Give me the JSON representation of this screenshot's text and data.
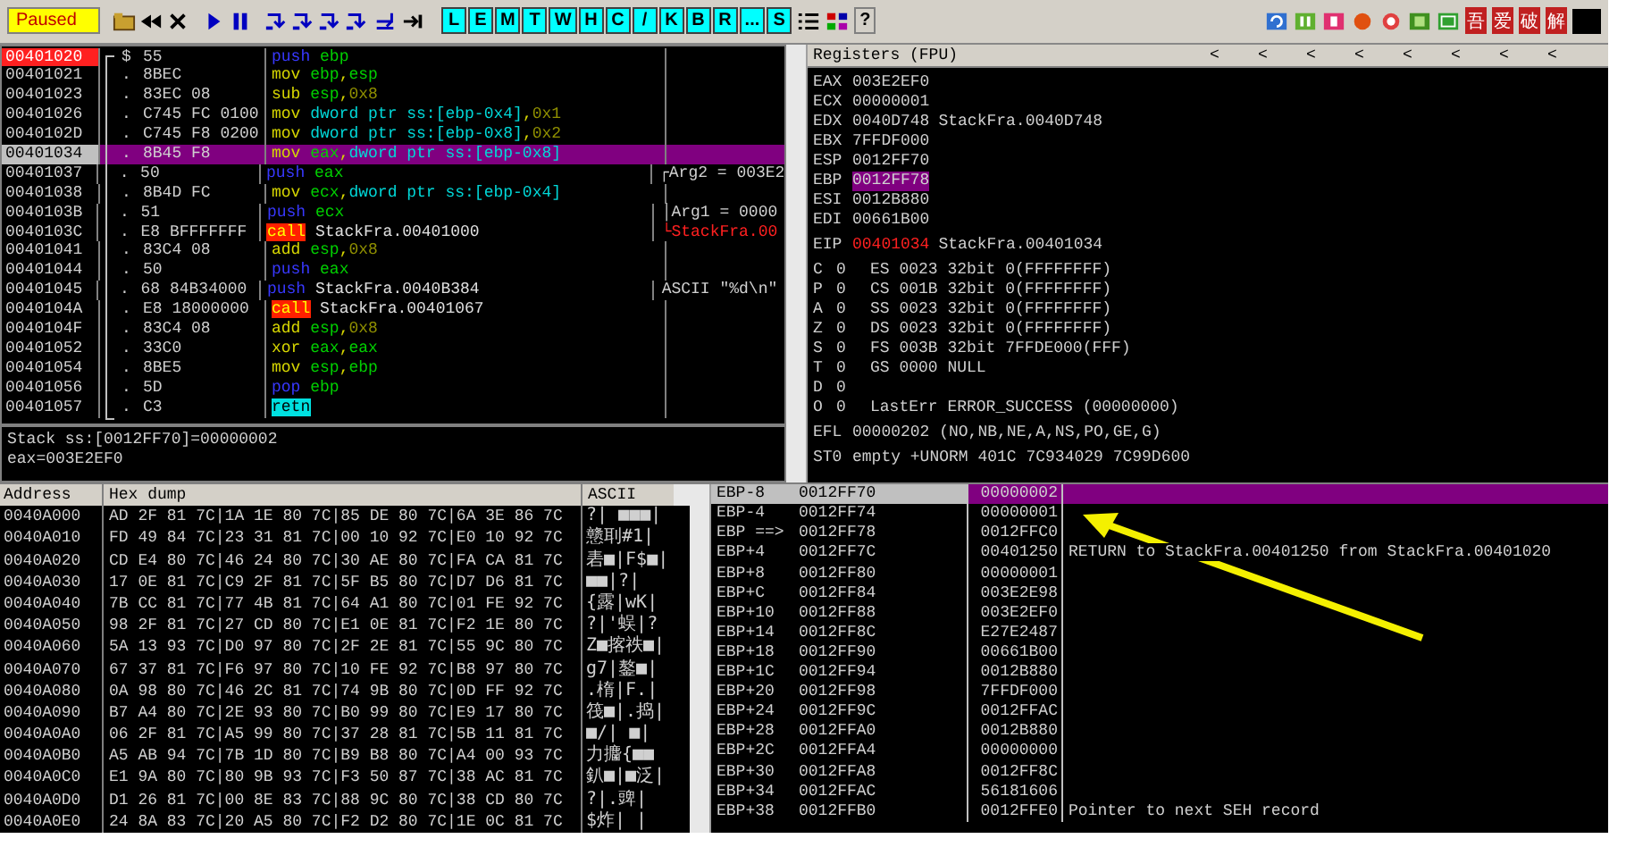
{
  "toolbar": {
    "status": "Paused",
    "letter_buttons": [
      "L",
      "E",
      "M",
      "T",
      "W",
      "H",
      "C",
      "/",
      "K",
      "B",
      "R",
      "...",
      "S"
    ],
    "help_button": "?",
    "brand_buttons": [
      "吾",
      "爱",
      "破",
      "解"
    ]
  },
  "disassembly": {
    "rows": [
      {
        "address": "00401020",
        "marker": "$",
        "bytes": "55",
        "mnemonic": {
          "text": "push",
          "kind": "stack"
        },
        "operands": [
          {
            "text": "ebp",
            "kind": "reg"
          }
        ],
        "breakpoint": true,
        "selected": false
      },
      {
        "address": "00401021",
        "marker": ".",
        "bytes": "8BEC",
        "mnemonic": {
          "text": "mov",
          "kind": "data"
        },
        "operands": [
          {
            "text": "ebp",
            "kind": "reg"
          },
          {
            "text": ",",
            "kind": "punct"
          },
          {
            "text": "esp",
            "kind": "reg"
          }
        ],
        "breakpoint": false,
        "selected": false
      },
      {
        "address": "00401023",
        "marker": ".",
        "bytes": "83EC 08",
        "mnemonic": {
          "text": "sub",
          "kind": "data"
        },
        "operands": [
          {
            "text": "esp",
            "kind": "reg"
          },
          {
            "text": ",",
            "kind": "punct"
          },
          {
            "text": "0x8",
            "kind": "imm"
          }
        ],
        "breakpoint": false,
        "selected": false
      },
      {
        "address": "00401026",
        "marker": ".",
        "bytes": "C745 FC 0100",
        "mnemonic": {
          "text": "mov",
          "kind": "data"
        },
        "operands": [
          {
            "text": "dword ptr ss:[ebp-0x4]",
            "kind": "mem"
          },
          {
            "text": ",",
            "kind": "punct"
          },
          {
            "text": "0x1",
            "kind": "imm"
          }
        ],
        "breakpoint": false,
        "selected": false
      },
      {
        "address": "0040102D",
        "marker": ".",
        "bytes": "C745 F8 0200",
        "mnemonic": {
          "text": "mov",
          "kind": "data"
        },
        "operands": [
          {
            "text": "dword ptr ss:[ebp-0x8]",
            "kind": "mem"
          },
          {
            "text": ",",
            "kind": "punct"
          },
          {
            "text": "0x2",
            "kind": "imm"
          }
        ],
        "breakpoint": false,
        "selected": false
      },
      {
        "address": "00401034",
        "marker": ".",
        "bytes": "8B45 F8",
        "mnemonic": {
          "text": "mov",
          "kind": "data"
        },
        "operands": [
          {
            "text": "eax",
            "kind": "reg"
          },
          {
            "text": ",",
            "kind": "punct"
          },
          {
            "text": "dword ptr ss:[ebp-0x8]",
            "kind": "mem"
          }
        ],
        "breakpoint": false,
        "selected": true
      },
      {
        "address": "00401037",
        "marker": ".",
        "bytes": "50",
        "mnemonic": {
          "text": "push",
          "kind": "stack"
        },
        "operands": [
          {
            "text": "eax",
            "kind": "reg"
          }
        ],
        "comment": {
          "text": "┌Arg2 = 003E2",
          "kind": "arg"
        },
        "breakpoint": false,
        "selected": false
      },
      {
        "address": "00401038",
        "marker": ".",
        "bytes": "8B4D FC",
        "mnemonic": {
          "text": "mov",
          "kind": "data"
        },
        "operands": [
          {
            "text": "ecx",
            "kind": "reg"
          },
          {
            "text": ",",
            "kind": "punct"
          },
          {
            "text": "dword ptr ss:[ebp-0x4]",
            "kind": "mem"
          }
        ],
        "breakpoint": false,
        "selected": false
      },
      {
        "address": "0040103B",
        "marker": ".",
        "bytes": "51",
        "mnemonic": {
          "text": "push",
          "kind": "stack"
        },
        "operands": [
          {
            "text": "ecx",
            "kind": "reg"
          }
        ],
        "comment": {
          "text": "│Arg1 = 0000",
          "kind": "arg"
        },
        "breakpoint": false,
        "selected": false
      },
      {
        "address": "0040103C",
        "marker": ".",
        "bytes": "E8 BFFFFFFF",
        "mnemonic": {
          "text": "call",
          "kind": "call"
        },
        "operands": [
          {
            "text": "StackFra.00401000",
            "kind": "sym"
          }
        ],
        "comment": {
          "text": "└StackFra.00",
          "kind": "target"
        },
        "breakpoint": false,
        "selected": false
      },
      {
        "address": "00401041",
        "marker": ".",
        "bytes": "83C4 08",
        "mnemonic": {
          "text": "add",
          "kind": "data"
        },
        "operands": [
          {
            "text": "esp",
            "kind": "reg"
          },
          {
            "text": ",",
            "kind": "punct"
          },
          {
            "text": "0x8",
            "kind": "imm"
          }
        ],
        "breakpoint": false,
        "selected": false
      },
      {
        "address": "00401044",
        "marker": ".",
        "bytes": "50",
        "mnemonic": {
          "text": "push",
          "kind": "stack"
        },
        "operands": [
          {
            "text": "eax",
            "kind": "reg"
          }
        ],
        "breakpoint": false,
        "selected": false
      },
      {
        "address": "00401045",
        "marker": ".",
        "bytes": "68 84B34000",
        "mnemonic": {
          "text": "push",
          "kind": "stack"
        },
        "operands": [
          {
            "text": "StackFra.0040B384",
            "kind": "sym"
          }
        ],
        "comment": {
          "text": "ASCII \"%d\\n\"",
          "kind": "arg"
        },
        "breakpoint": false,
        "selected": false
      },
      {
        "address": "0040104A",
        "marker": ".",
        "bytes": "E8 18000000",
        "mnemonic": {
          "text": "call",
          "kind": "call"
        },
        "operands": [
          {
            "text": "StackFra.00401067",
            "kind": "sym"
          }
        ],
        "breakpoint": false,
        "selected": false
      },
      {
        "address": "0040104F",
        "marker": ".",
        "bytes": "83C4 08",
        "mnemonic": {
          "text": "add",
          "kind": "data"
        },
        "operands": [
          {
            "text": "esp",
            "kind": "reg"
          },
          {
            "text": ",",
            "kind": "punct"
          },
          {
            "text": "0x8",
            "kind": "imm"
          }
        ],
        "breakpoint": false,
        "selected": false
      },
      {
        "address": "00401052",
        "marker": ".",
        "bytes": "33C0",
        "mnemonic": {
          "text": "xor",
          "kind": "data"
        },
        "operands": [
          {
            "text": "eax",
            "kind": "reg"
          },
          {
            "text": ",",
            "kind": "punct"
          },
          {
            "text": "eax",
            "kind": "reg"
          }
        ],
        "breakpoint": false,
        "selected": false
      },
      {
        "address": "00401054",
        "marker": ".",
        "bytes": "8BE5",
        "mnemonic": {
          "text": "mov",
          "kind": "data"
        },
        "operands": [
          {
            "text": "esp",
            "kind": "reg"
          },
          {
            "text": ",",
            "kind": "punct"
          },
          {
            "text": "ebp",
            "kind": "reg"
          }
        ],
        "breakpoint": false,
        "selected": false
      },
      {
        "address": "00401056",
        "marker": ".",
        "bytes": "5D",
        "mnemonic": {
          "text": "pop",
          "kind": "stack"
        },
        "operands": [
          {
            "text": "ebp",
            "kind": "reg"
          }
        ],
        "breakpoint": false,
        "selected": false
      },
      {
        "address": "00401057",
        "marker": ".",
        "bytes": "C3",
        "mnemonic": {
          "text": "retn",
          "kind": "ret"
        },
        "operands": [],
        "breakpoint": false,
        "selected": false
      }
    ]
  },
  "info": [
    "Stack ss:[0012FF70]=00000002",
    "eax=003E2EF0"
  ],
  "registers": {
    "title": "Registers (FPU)",
    "header_arrows": [
      "<",
      "<",
      "<",
      "<",
      "<",
      "<",
      "<",
      "<"
    ],
    "general": [
      {
        "name": "EAX",
        "value": "003E2EF0",
        "changed": false,
        "selected": false
      },
      {
        "name": "ECX",
        "value": "00000001",
        "changed": false,
        "selected": false
      },
      {
        "name": "EDX",
        "value": "0040D748",
        "note": "StackFra.0040D748",
        "changed": false,
        "selected": false
      },
      {
        "name": "EBX",
        "value": "7FFDF000",
        "changed": false,
        "selected": false
      },
      {
        "name": "ESP",
        "value": "0012FF70",
        "changed": false,
        "selected": false
      },
      {
        "name": "EBP",
        "value": "0012FF78",
        "changed": false,
        "selected": true
      },
      {
        "name": "ESI",
        "value": "0012B880",
        "changed": false,
        "selected": false
      },
      {
        "name": "EDI",
        "value": "00661B00",
        "changed": false,
        "selected": false
      }
    ],
    "eip": {
      "name": "EIP",
      "value": "00401034",
      "note": "StackFra.00401034",
      "changed": true,
      "selected": false
    },
    "flags": [
      {
        "flag": "C",
        "value": "0",
        "segment": "ES 0023 32bit 0(FFFFFFFF)"
      },
      {
        "flag": "P",
        "value": "0",
        "segment": "CS 001B 32bit 0(FFFFFFFF)"
      },
      {
        "flag": "A",
        "value": "0",
        "segment": "SS 0023 32bit 0(FFFFFFFF)"
      },
      {
        "flag": "Z",
        "value": "0",
        "segment": "DS 0023 32bit 0(FFFFFFFF)"
      },
      {
        "flag": "S",
        "value": "0",
        "segment": "FS 003B 32bit 7FFDE000(FFF)"
      },
      {
        "flag": "T",
        "value": "0",
        "segment": "GS 0000 NULL"
      },
      {
        "flag": "D",
        "value": "0"
      },
      {
        "flag": "O",
        "value": "0",
        "segment": "LastErr ERROR_SUCCESS (00000000)"
      }
    ],
    "efl": {
      "name": "EFL",
      "value": "00000202 (NO,NB,NE,A,NS,PO,GE,G)"
    },
    "fpu": [
      {
        "name": "ST0",
        "value": "empty +UNORM 401C 7C934029 7C99D600"
      }
    ]
  },
  "dump": {
    "columns": [
      "Address",
      "Hex dump",
      "ASCII"
    ],
    "rows": [
      {
        "address": "0040A000",
        "hex": "AD 2F 81 7C|1A 1E 80 7C|85 DE 80 7C|6A 3E 86 7C",
        "ascii": "?| ■■■|"
      },
      {
        "address": "0040A010",
        "hex": "FD 49 84 7C|23 31 81 7C|00 10 92 7C|E0 10 92 7C",
        "ascii": "戆刵#1|"
      },
      {
        "address": "0040A020",
        "hex": "CD E4 80 7C|46 24 80 7C|30 AE 80 7C|FA CA 81 7C",
        "ascii": "砉■|F$■|"
      },
      {
        "address": "0040A030",
        "hex": "17 0E 81 7C|C9 2F 81 7C|5F B5 80 7C|D7 D6 81 7C",
        "ascii": "■■|?|"
      },
      {
        "address": "0040A040",
        "hex": "7B CC 81 7C|77 4B 81 7C|64 A1 80 7C|01 FE 92 7C",
        "ascii": "{露|wK|"
      },
      {
        "address": "0040A050",
        "hex": "98 2F 81 7C|27 CD 80 7C|E1 0E 81 7C|F2 1E 80 7C",
        "ascii": "?|'蜈|?"
      },
      {
        "address": "0040A060",
        "hex": "5A 13 93 7C|D0 97 80 7C|2F 2E 81 7C|55 9C 80 7C",
        "ascii": "Z■揢祑■|"
      },
      {
        "address": "0040A070",
        "hex": "67 37 81 7C|F6 97 80 7C|10 FE 92 7C|B8 97 80 7C",
        "ascii": "g7|鏊■|"
      },
      {
        "address": "0040A080",
        "hex": "0A 98 80 7C|46 2C 81 7C|74 9B 80 7C|0D FF 92 7C",
        "ascii": ".楕|F.|"
      },
      {
        "address": "0040A090",
        "hex": "B7 A4 80 7C|2E 93 80 7C|B0 99 80 7C|E9 17 80 7C",
        "ascii": "筏■|.捣|"
      },
      {
        "address": "0040A0A0",
        "hex": "06 2F 81 7C|A5 99 80 7C|37 28 81 7C|5B 11 81 7C",
        "ascii": "■/| ■|"
      },
      {
        "address": "0040A0B0",
        "hex": "A5 AB 94 7C|7B 1D 80 7C|B9 B8 80 7C|A4 00 93 7C",
        "ascii": "力攟{■■"
      },
      {
        "address": "0040A0C0",
        "hex": "E1 9A 80 7C|80 9B 93 7C|F3 50 87 7C|38 AC 81 7C",
        "ascii": "釟■|■泛|"
      },
      {
        "address": "0040A0D0",
        "hex": "D1 26 81 7C|00 8E 83 7C|88 9C 80 7C|38 CD 80 7C",
        "ascii": "?|.豍|"
      },
      {
        "address": "0040A0E0",
        "hex": "24 8A 83 7C|20 A5 80 7C|F2 D2 80 7C|1E 0C 81 7C",
        "ascii": "$炸| |"
      }
    ]
  },
  "stack": {
    "rows": [
      {
        "label": "EBP-8",
        "address": "0012FF70",
        "value": "00000002",
        "selected": true
      },
      {
        "label": "EBP-4",
        "address": "0012FF74",
        "value": "00000001",
        "selected": false
      },
      {
        "label": "EBP ==>",
        "address": "0012FF78",
        "value": "0012FFC0",
        "selected": false
      },
      {
        "label": "EBP+4",
        "address": "0012FF7C",
        "value": "00401250",
        "comment": "RETURN to StackFra.00401250 from StackFra.00401020",
        "selected": false
      },
      {
        "label": "EBP+8",
        "address": "0012FF80",
        "value": "00000001",
        "selected": false
      },
      {
        "label": "EBP+C",
        "address": "0012FF84",
        "value": "003E2E98",
        "selected": false
      },
      {
        "label": "EBP+10",
        "address": "0012FF88",
        "value": "003E2EF0",
        "selected": false
      },
      {
        "label": "EBP+14",
        "address": "0012FF8C",
        "value": "E27E2487",
        "selected": false
      },
      {
        "label": "EBP+18",
        "address": "0012FF90",
        "value": "00661B00",
        "selected": false
      },
      {
        "label": "EBP+1C",
        "address": "0012FF94",
        "value": "0012B880",
        "selected": false
      },
      {
        "label": "EBP+20",
        "address": "0012FF98",
        "value": "7FFDF000",
        "selected": false
      },
      {
        "label": "EBP+24",
        "address": "0012FF9C",
        "value": "0012FFAC",
        "selected": false
      },
      {
        "label": "EBP+28",
        "address": "0012FFA0",
        "value": "0012B880",
        "selected": false
      },
      {
        "label": "EBP+2C",
        "address": "0012FFA4",
        "value": "00000000",
        "selected": false
      },
      {
        "label": "EBP+30",
        "address": "0012FFA8",
        "value": "0012FF8C",
        "selected": false
      },
      {
        "label": "EBP+34",
        "address": "0012FFAC",
        "value": "56181606",
        "selected": false
      },
      {
        "label": "EBP+38",
        "address": "0012FFB0",
        "value": "0012FFE0",
        "comment": "Pointer to next SEH record",
        "selected": false
      }
    ]
  }
}
